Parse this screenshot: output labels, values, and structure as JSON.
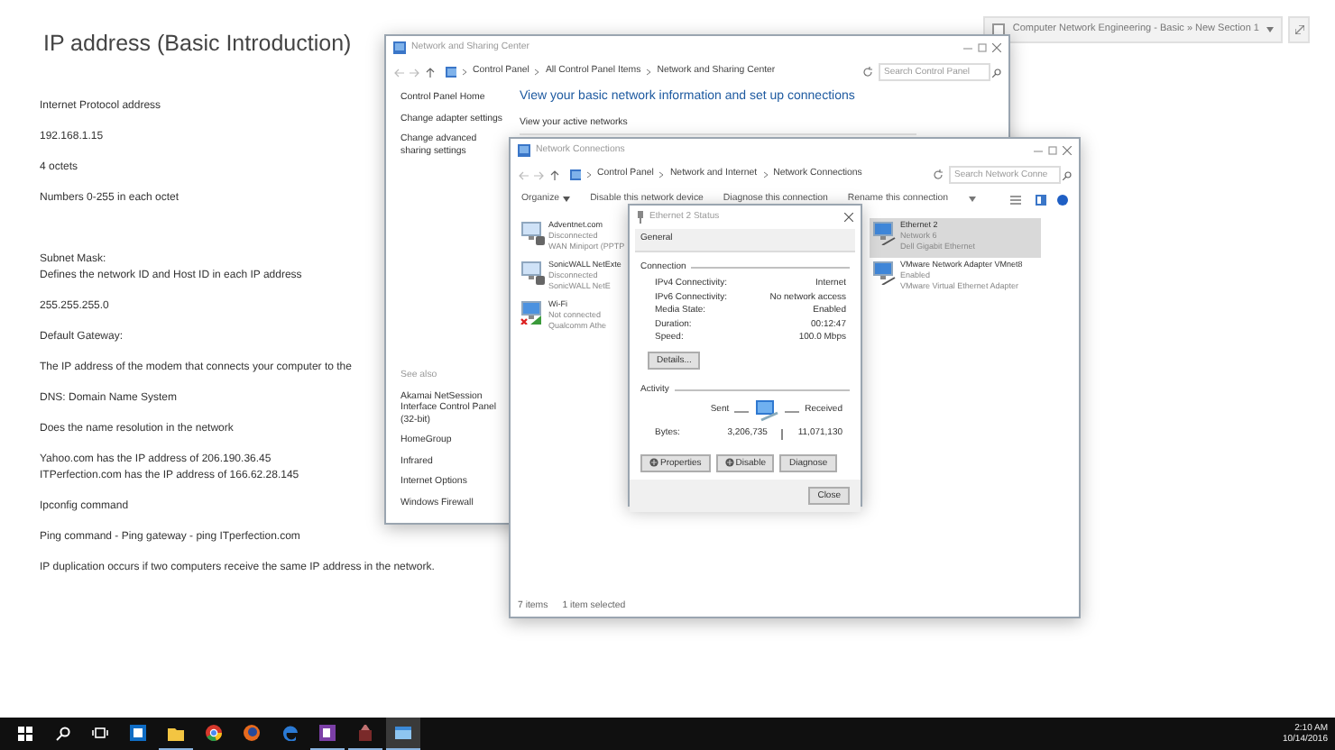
{
  "notes": {
    "title": "IP address (Basic Introduction)",
    "paragraphs": [
      {
        "lines": [
          "Internet Protocol address"
        ],
        "gap_before": false
      },
      {
        "lines": [
          "192.168.1.15"
        ],
        "gap_before": false
      },
      {
        "lines": [
          "4 octets"
        ],
        "gap_before": false
      },
      {
        "lines": [
          "Numbers 0-255 in each octet"
        ],
        "gap_before": false
      },
      {
        "lines": [
          "Subnet Mask:",
          "Defines the network ID and Host ID in each IP address"
        ],
        "gap_before": true
      },
      {
        "lines": [
          "255.255.255.0"
        ],
        "gap_before": false
      },
      {
        "lines": [
          "Default Gateway:"
        ],
        "gap_before": false
      },
      {
        "lines": [
          "The IP address of the modem that connects your computer to the"
        ],
        "gap_before": false
      },
      {
        "lines": [
          "DNS: Domain Name System"
        ],
        "gap_before": false
      },
      {
        "lines": [
          "Does the name resolution in the network"
        ],
        "gap_before": false
      },
      {
        "lines": [
          "Yahoo.com  has the IP address of 206.190.36.45",
          "ITPerfection.com has the IP address of 166.62.28.145"
        ],
        "gap_before": false
      },
      {
        "lines": [
          "Ipconfig command"
        ],
        "gap_before": false
      },
      {
        "lines": [
          "Ping command - Ping gateway - ping ITperfection.com"
        ],
        "gap_before": false
      },
      {
        "lines": [
          "IP duplication occurs if two computers receive the same IP address in the network."
        ],
        "gap_before": false
      }
    ]
  },
  "section_bar": {
    "path": "Computer Network Engineering - Basic » New Section 1"
  },
  "nsc_window": {
    "title": "Network and Sharing Center",
    "breadcrumb": [
      "Control Panel",
      "All Control Panel Items",
      "Network and Sharing Center"
    ],
    "search_placeholder": "Search Control Panel",
    "tasks": [
      "Control Panel Home",
      "Change adapter settings",
      "Change advanced sharing settings"
    ],
    "see_also_title": "See also",
    "see_also": [
      "Akamai NetSession Interface Control Panel (32-bit)",
      "HomeGroup",
      "Infrared",
      "Internet Options",
      "Windows Firewall"
    ],
    "heading": "View your basic network information and set up connections",
    "subheading": "View your active networks"
  },
  "nc_window": {
    "title": "Network Connections",
    "breadcrumb": [
      "Control Panel",
      "Network and Internet",
      "Network Connections"
    ],
    "search_placeholder": "Search Network Conne",
    "toolbar": [
      "Organize",
      "Disable this network device",
      "Diagnose this connection",
      "Rename this connection"
    ],
    "adapters": [
      {
        "kind": "vpn",
        "name": "Adventnet.com",
        "status": "Disconnected",
        "device": "WAN Miniport (PPTP",
        "selected": false
      },
      {
        "kind": "vpn",
        "name": "SonicWALL NetExte",
        "status": "Disconnected",
        "device": "SonicWALL NetE",
        "selected": false
      },
      {
        "kind": "wifi",
        "name": "Wi-Fi",
        "status": "Not connected",
        "device": "Qualcomm Athe",
        "selected": false
      },
      {
        "kind": "ethernet",
        "name": "Ethernet 2",
        "status": "Network 6",
        "device": "Dell Gigabit Ethernet",
        "selected": true
      },
      {
        "kind": "ethernet",
        "name": "VMware Network Adapter VMnet8",
        "status": "Enabled",
        "device": "VMware Virtual Ethernet Adapter",
        "selected": false
      }
    ],
    "status_bar": {
      "count": "7 items",
      "selection": "1 item selected"
    }
  },
  "status_dialog": {
    "title": "Ethernet 2 Status",
    "tab": "General",
    "connection_title": "Connection",
    "connection": [
      {
        "label": "IPv4 Connectivity:",
        "value": "Internet"
      },
      {
        "label": "IPv6 Connectivity:",
        "value": "No network access"
      },
      {
        "label": "Media State:",
        "value": "Enabled"
      },
      {
        "label": "Duration:",
        "value": "00:12:47"
      },
      {
        "label": "Speed:",
        "value": "100.0 Mbps"
      }
    ],
    "details_button": "Details...",
    "activity_title": "Activity",
    "sent": "Sent",
    "received": "Received",
    "bytes_label": "Bytes:",
    "bytes_sent": "3,206,735",
    "bytes_received": "11,071,130",
    "buttons": [
      "Properties",
      "Disable",
      "Diagnose"
    ],
    "close": "Close"
  },
  "taskbar": {
    "apps": [
      {
        "kind": "outlook",
        "running": false,
        "selected": false
      },
      {
        "kind": "explorer",
        "running": true,
        "selected": false
      },
      {
        "kind": "chrome",
        "running": false,
        "selected": false
      },
      {
        "kind": "firefox",
        "running": false,
        "selected": false
      },
      {
        "kind": "edge",
        "running": false,
        "selected": false
      },
      {
        "kind": "onenote",
        "running": true,
        "selected": false
      },
      {
        "kind": "tool",
        "running": true,
        "selected": false
      },
      {
        "kind": "window",
        "running": true,
        "selected": true
      }
    ],
    "time": "2:10 AM",
    "date": "10/14/2016"
  }
}
